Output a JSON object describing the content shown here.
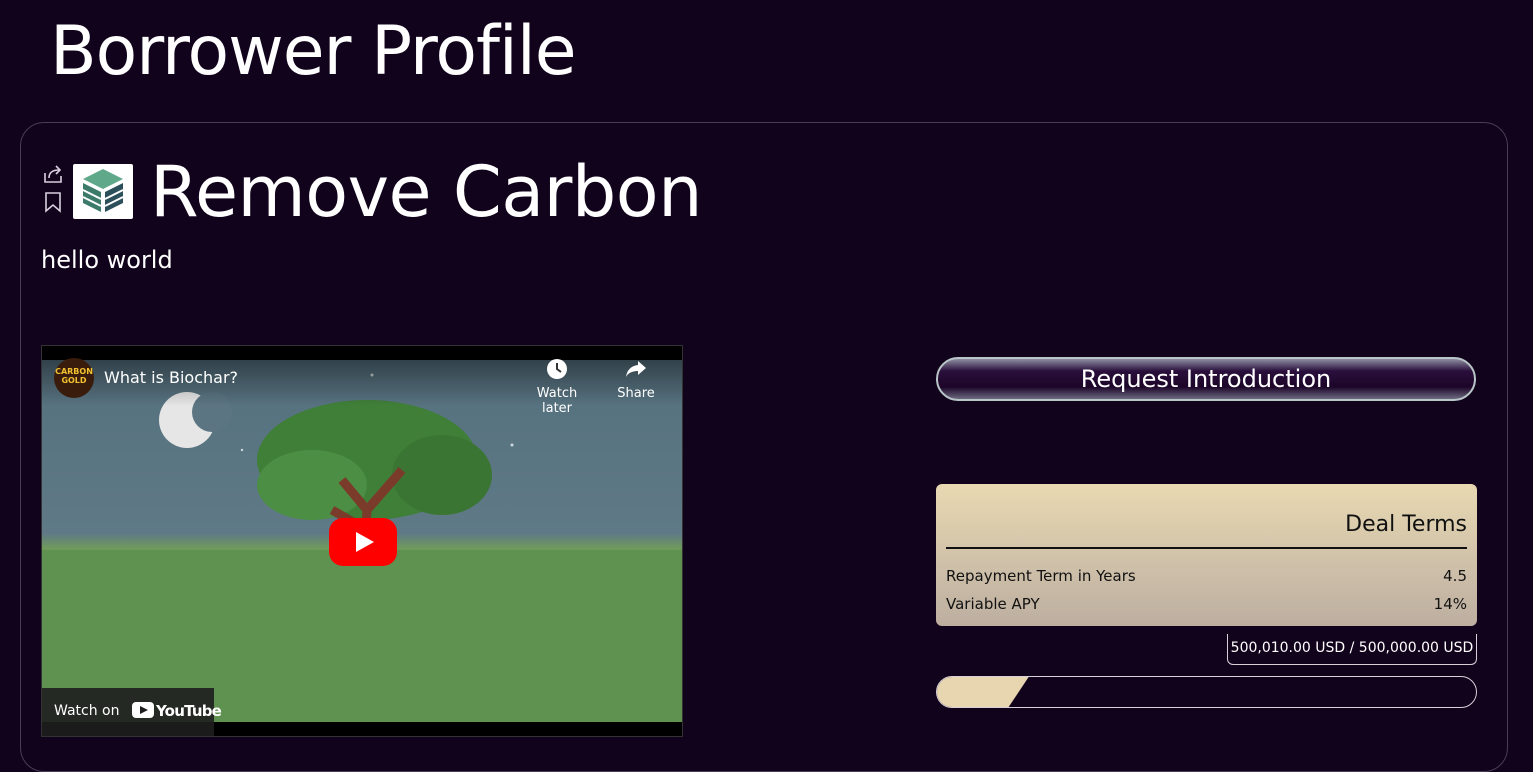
{
  "page": {
    "title": "Borrower Profile"
  },
  "borrower": {
    "name": "Remove Carbon",
    "tagline": "hello world",
    "icons": {
      "share": "share-icon",
      "bookmark": "bookmark-icon",
      "logo": "cube-logo"
    }
  },
  "video": {
    "title": "What is Biochar?",
    "channel_badge": "CARBON GOLD",
    "watch_later_label": "Watch later",
    "share_label": "Share",
    "watch_on_label": "Watch on",
    "platform_label": "YouTube"
  },
  "actions": {
    "request_intro_label": "Request Introduction"
  },
  "deal_terms": {
    "title": "Deal Terms",
    "rows": [
      {
        "label": "Repayment Term in Years",
        "value": "4.5"
      },
      {
        "label": "Variable APY",
        "value": "14%"
      }
    ]
  },
  "funding": {
    "amount_text": "500,010.00 USD / 500,000.00 USD",
    "progress_fraction": 0.17
  },
  "colors": {
    "background": "#12031c",
    "deal_card": "#e9d9b2",
    "progress_fill": "#e8d6b0",
    "play_button": "#ff0000"
  }
}
